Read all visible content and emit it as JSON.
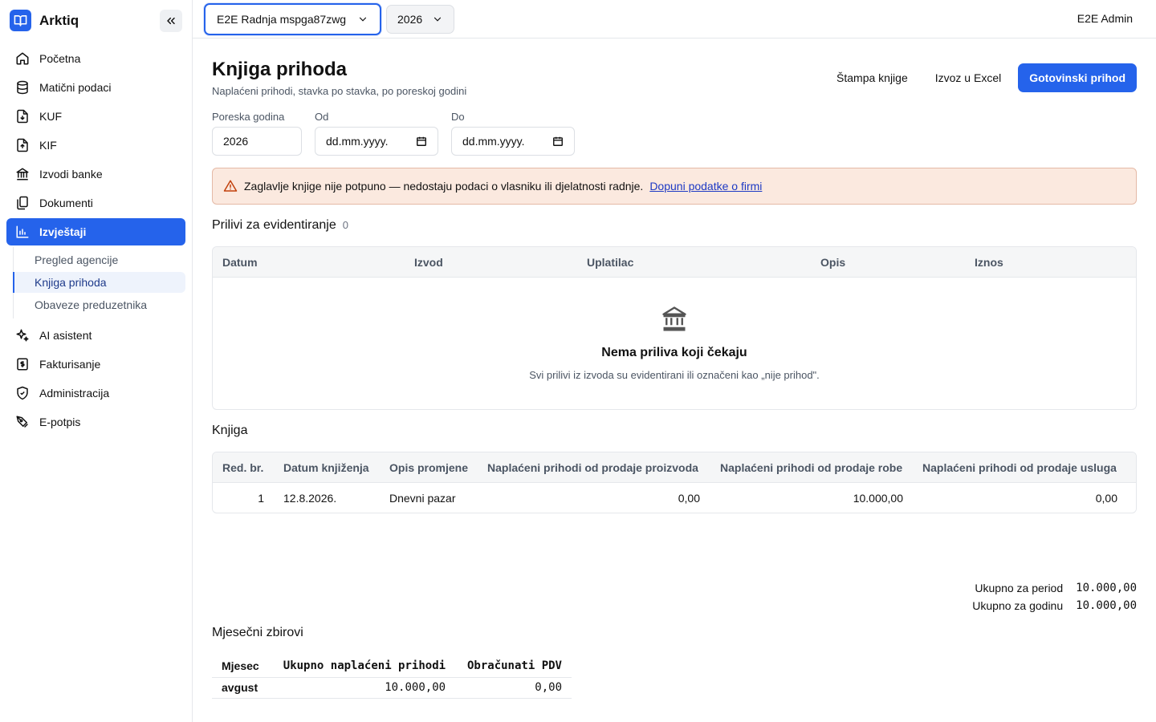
{
  "brand": {
    "name": "Arktiq"
  },
  "sidebar": {
    "items": [
      {
        "label": "Početna",
        "icon": "home-icon"
      },
      {
        "label": "Matični podaci",
        "icon": "database-icon"
      },
      {
        "label": "KUF",
        "icon": "file-download-icon"
      },
      {
        "label": "KIF",
        "icon": "file-upload-icon"
      },
      {
        "label": "Izvodi banke",
        "icon": "bank-icon"
      },
      {
        "label": "Dokumenti",
        "icon": "documents-icon"
      },
      {
        "label": "Izvještaji",
        "icon": "chart-bar-icon",
        "active": true
      }
    ],
    "sub_items": [
      {
        "label": "Pregled agencije"
      },
      {
        "label": "Knjiga prihoda",
        "active": true
      },
      {
        "label": "Obaveze preduzetnika"
      }
    ],
    "items_after": [
      {
        "label": "AI asistent",
        "icon": "sparkles-icon"
      },
      {
        "label": "Fakturisanje",
        "icon": "invoice-dollar-icon"
      },
      {
        "label": "Administracija",
        "icon": "shield-check-icon"
      },
      {
        "label": "E-potpis",
        "icon": "pen-signature-icon"
      }
    ]
  },
  "topbar": {
    "company": "E2E Radnja mspga87zwg",
    "year": "2026",
    "user": "E2E Admin"
  },
  "page": {
    "title": "Knjiga prihoda",
    "subtitle": "Naplaćeni prihodi, stavka po stavka, po poreskoj godini",
    "actions": {
      "print": "Štampa knjige",
      "export": "Izvoz u Excel",
      "cash": "Gotovinski prihod"
    }
  },
  "filters": {
    "year_label": "Poreska godina",
    "year_value": "2026",
    "from_label": "Od",
    "from_placeholder": "dd.mm.yyyy.",
    "to_label": "Do",
    "to_placeholder": "dd.mm.yyyy."
  },
  "alert": {
    "text": "Zaglavlje knjige nije potpuno — nedostaju podaci o vlasniku ili djelatnosti radnje.",
    "link": "Dopuni podatke o firmi"
  },
  "inflows": {
    "title": "Prilivi za evidentiranje",
    "count": "0",
    "columns": [
      "Datum",
      "Izvod",
      "Uplatilac",
      "Opis",
      "Iznos"
    ],
    "empty_title": "Nema priliva koji čekaju",
    "empty_desc": "Svi prilivi iz izvoda su evidentirani ili označeni kao „nije prihod\"."
  },
  "book": {
    "title": "Knjiga",
    "columns": [
      "Red. br.",
      "Datum knjiženja",
      "Opis promjene",
      "Naplaćeni prihodi od prodaje proizvoda",
      "Naplaćeni prihodi od prodaje robe",
      "Naplaćeni prihodi od prodaje usluga"
    ],
    "rows": [
      [
        "1",
        "12.8.2026.",
        "Dnevni pazar",
        "0,00",
        "10.000,00",
        "0,00"
      ]
    ]
  },
  "totals": {
    "period_label": "Ukupno za period",
    "period_value": "10.000,00",
    "year_label": "Ukupno za godinu",
    "year_value": "10.000,00"
  },
  "monthly": {
    "title": "Mjesečni zbirovi",
    "columns": [
      "Mjesec",
      "Ukupno naplaćeni prihodi",
      "Obračunati PDV"
    ],
    "rows": [
      [
        "avgust",
        "10.000,00",
        "0,00"
      ]
    ]
  }
}
